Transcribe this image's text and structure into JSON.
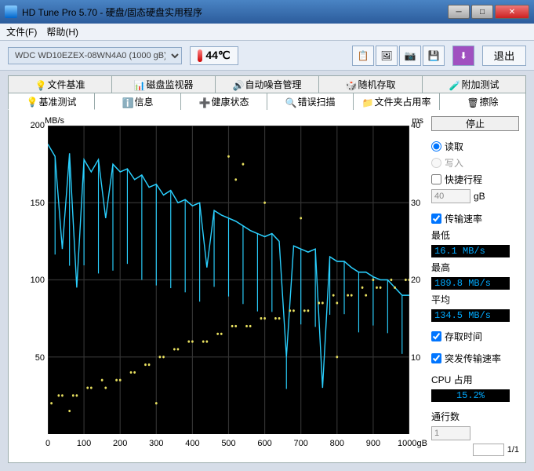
{
  "window": {
    "title": "HD Tune Pro 5.70 - 硬盘/固态硬盘实用程序"
  },
  "menu": {
    "file": "文件(F)",
    "help": "帮助(H)"
  },
  "toolbar": {
    "drive": "WDC WD10EZEX-08WN4A0 (1000 gB)",
    "temp": "44℃",
    "exit": "退出"
  },
  "tabs_row1": [
    "文件基准",
    "磁盘监视器",
    "自动噪音管理",
    "随机存取",
    "附加测试"
  ],
  "tabs_row2": [
    "基准测试",
    "信息",
    "健康状态",
    "错误扫描",
    "文件夹占用率",
    "擦除"
  ],
  "side": {
    "run": "停止",
    "read": "读取",
    "write": "写入",
    "short": "快捷行程",
    "short_val": "40",
    "gb": "gB",
    "transfer": "传输速率",
    "min_l": "最低",
    "min_v": "16.1 MB/s",
    "max_l": "最高",
    "max_v": "189.8 MB/s",
    "avg_l": "平均",
    "avg_v": "134.5 MB/s",
    "access": "存取时间",
    "burst": "突发传输速率",
    "cpu_l": "CPU 占用",
    "cpu_v": "15.2%",
    "pass_l": "通行数",
    "pass_v": "1",
    "pass_c": "1/1"
  },
  "chart_data": {
    "type": "line",
    "xlabel": "gB",
    "ylabel_left": "MB/s",
    "ylabel_right": "ms",
    "xlim": [
      0,
      1000
    ],
    "ylim_left": [
      0,
      200
    ],
    "ylim_right": [
      0,
      40
    ],
    "xticks": [
      0,
      100,
      200,
      300,
      400,
      500,
      600,
      700,
      800,
      900,
      1000
    ],
    "yticks_left": [
      50,
      100,
      150,
      200
    ],
    "yticks_right": [
      10,
      20,
      30,
      40
    ],
    "series": [
      {
        "name": "transfer",
        "color": "#2ad0ff",
        "unit": "MB/s",
        "x": [
          0,
          20,
          40,
          60,
          80,
          100,
          120,
          140,
          160,
          180,
          200,
          220,
          240,
          260,
          280,
          300,
          320,
          340,
          360,
          380,
          400,
          420,
          440,
          460,
          480,
          500,
          520,
          540,
          560,
          580,
          600,
          620,
          640,
          660,
          680,
          700,
          720,
          740,
          760,
          780,
          800,
          820,
          840,
          860,
          880,
          900,
          920,
          940,
          960,
          980,
          1000
        ],
        "y": [
          188,
          180,
          120,
          182,
          95,
          178,
          170,
          178,
          140,
          175,
          170,
          172,
          165,
          168,
          160,
          162,
          155,
          158,
          150,
          152,
          148,
          150,
          108,
          145,
          142,
          140,
          138,
          135,
          132,
          130,
          128,
          130,
          125,
          50,
          122,
          120,
          118,
          120,
          30,
          115,
          112,
          112,
          108,
          105,
          105,
          102,
          100,
          100,
          95,
          90,
          90
        ]
      },
      {
        "name": "access",
        "color": "#e8e060",
        "unit": "ms",
        "type": "scatter",
        "x": [
          10,
          40,
          80,
          120,
          160,
          200,
          240,
          280,
          320,
          360,
          400,
          440,
          480,
          520,
          560,
          600,
          640,
          680,
          720,
          760,
          800,
          840,
          880,
          920,
          960,
          1000,
          30,
          70,
          110,
          150,
          190,
          230,
          270,
          310,
          350,
          390,
          430,
          470,
          510,
          550,
          590,
          630,
          670,
          710,
          750,
          790,
          830,
          870,
          910,
          950,
          990,
          500,
          520,
          540,
          300,
          60,
          600,
          700,
          800,
          900
        ],
        "y": [
          4,
          5,
          5,
          6,
          6,
          7,
          8,
          9,
          10,
          11,
          12,
          12,
          13,
          14,
          14,
          15,
          15,
          16,
          16,
          17,
          17,
          18,
          18,
          19,
          19,
          20,
          5,
          5,
          6,
          7,
          7,
          8,
          9,
          10,
          11,
          12,
          12,
          13,
          14,
          14,
          15,
          15,
          16,
          16,
          17,
          18,
          18,
          19,
          19,
          20,
          20,
          36,
          33,
          35,
          4,
          3,
          30,
          28,
          10,
          20
        ]
      }
    ]
  }
}
